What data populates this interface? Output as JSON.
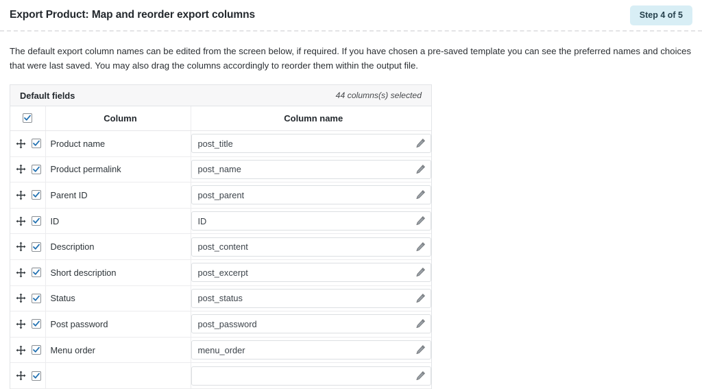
{
  "header": {
    "title": "Export Product: Map and reorder export columns",
    "step_badge": "Step 4 of 5"
  },
  "intro": {
    "paragraph": "The default export column names can be edited from the screen below, if required. If you have chosen a pre-saved template you can see the preferred names and choices that were last saved. You may also drag the columns accordingly to reorder them within the output file."
  },
  "panel": {
    "title": "Default fields",
    "count_text": "44 columns(s) selected",
    "columns": {
      "column_header": "Column",
      "column_name_header": "Column name"
    },
    "rows": [
      {
        "label": "Product name",
        "value": "post_title",
        "checked": true
      },
      {
        "label": "Product permalink",
        "value": "post_name",
        "checked": true
      },
      {
        "label": "Parent ID",
        "value": "post_parent",
        "checked": true
      },
      {
        "label": "ID",
        "value": "ID",
        "checked": true
      },
      {
        "label": "Description",
        "value": "post_content",
        "checked": true
      },
      {
        "label": "Short description",
        "value": "post_excerpt",
        "checked": true
      },
      {
        "label": "Status",
        "value": "post_status",
        "checked": true
      },
      {
        "label": "Post password",
        "value": "post_password",
        "checked": true
      },
      {
        "label": "Menu order",
        "value": "menu_order",
        "checked": true
      },
      {
        "label": "",
        "value": "",
        "checked": true
      }
    ]
  },
  "colors": {
    "badge_bg": "#d8eef5",
    "checkbox_check": "#2271b1",
    "panel_head_bg": "#f7f7f8",
    "border": "#e2e4e7"
  },
  "icons": {
    "drag": "drag-move-icon",
    "edit": "pencil-icon",
    "check": "check-icon"
  }
}
